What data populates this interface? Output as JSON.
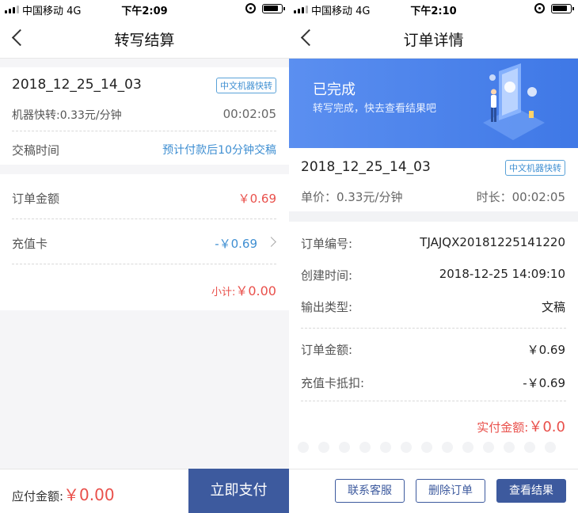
{
  "left": {
    "status": {
      "carrier": "中国移动  4G",
      "time": "下午2:09"
    },
    "nav": {
      "title": "转写结算"
    },
    "file": {
      "name": "2018_12_25_14_03",
      "tag": "中文机器快转"
    },
    "rate": {
      "label": "机器快转:0.33元/分钟",
      "duration": "00:02:05"
    },
    "delivery": {
      "label": "交稿时间",
      "value": "预计付款后10分钟交稿"
    },
    "order_amount": {
      "label": "订单金额",
      "value": "￥0.69"
    },
    "card": {
      "label": "充值卡",
      "value": "-￥0.69"
    },
    "subtotal": {
      "label": "小计:",
      "value": "￥0.00"
    },
    "payable": {
      "label": "应付金额:",
      "value": "￥0.00"
    },
    "pay_button": "立即支付"
  },
  "right": {
    "status": {
      "carrier": "中国移动  4G",
      "time": "下午2:10"
    },
    "nav": {
      "title": "订单详情"
    },
    "banner": {
      "status": "已完成",
      "subtitle": "转写完成，快去查看结果吧"
    },
    "file": {
      "name": "2018_12_25_14_03",
      "tag": "中文机器快转"
    },
    "unit_price": "单价：0.33元/分钟",
    "duration": "时长：00:02:05",
    "details": [
      {
        "label": "订单编号:",
        "value": "TJAJQX20181225141220"
      },
      {
        "label": "创建时间:",
        "value": "2018-12-25 14:09:10"
      },
      {
        "label": "输出类型:",
        "value": "文稿"
      }
    ],
    "amounts": [
      {
        "label": "订单金额:",
        "value": "￥0.69"
      },
      {
        "label": "充值卡抵扣:",
        "value": "-￥0.69"
      }
    ],
    "paid": {
      "label": "实付金额:",
      "value": "￥0.0"
    },
    "buttons": {
      "contact": "联系客服",
      "delete": "删除订单",
      "view": "查看结果"
    }
  },
  "colors": {
    "accent_blue": "#3d5a9e",
    "link_blue": "#3f8fd2",
    "price_red": "#e9504b",
    "banner_blue": "#4a83ec"
  },
  "icons": [
    "signal-icon",
    "orientation-lock-icon",
    "battery-icon",
    "back-chevron-icon",
    "chevron-right-icon"
  ]
}
